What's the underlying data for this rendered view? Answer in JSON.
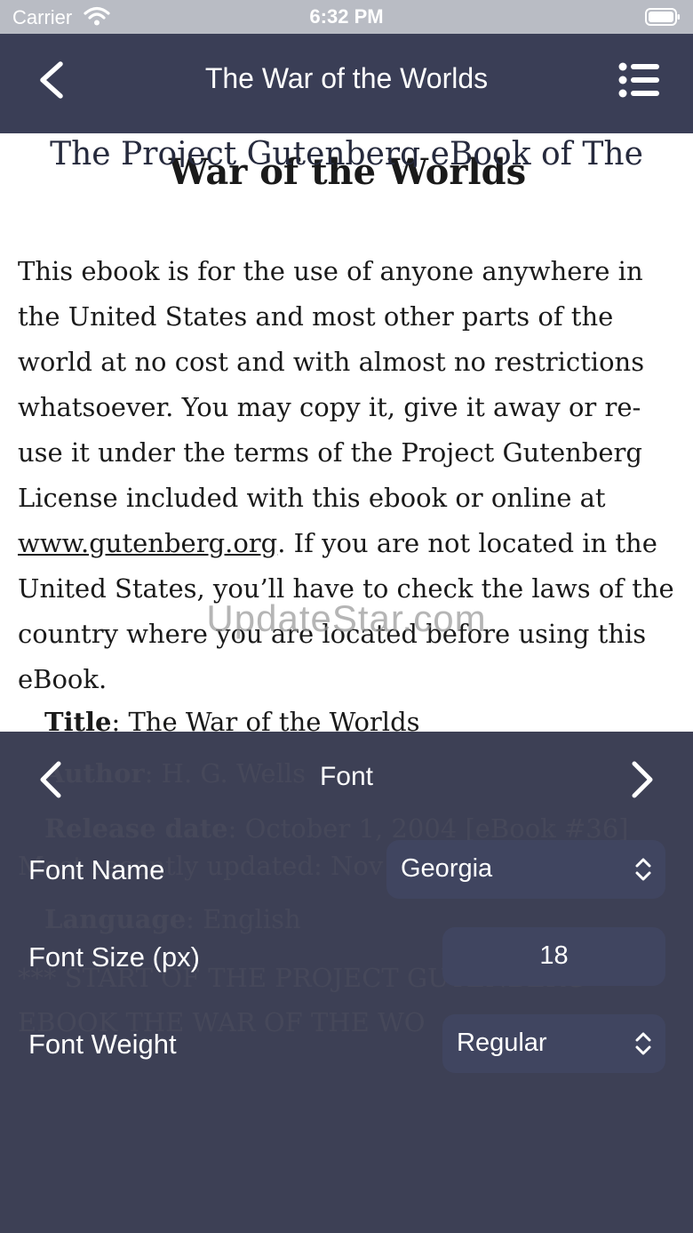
{
  "status_bar": {
    "carrier": "Carrier",
    "time": "6:32 PM"
  },
  "nav": {
    "title": "The War of the Worlds",
    "ghost_heading": "The Project Gutenberg eBook of The"
  },
  "book": {
    "heading": "War of the Worlds",
    "para_before_link": "This ebook is for the use of anyone anywhere in the United States and most other parts of the world at no cost and with almost no restrictions whatsoever. You may copy it, give it away or re-use it under the terms of the Project Gutenberg License included with this ebook or online at ",
    "link": "www.gutenberg.org",
    "para_after_link": ". If you are not located in the United States, you’ll have to check the laws of the country where you are located before using this eBook.",
    "title_label": "Title",
    "title_value": ": The War of the Worlds",
    "author_label": "Author",
    "author_value": ": H. G. Wells",
    "release_label": "Release date",
    "release_value": ": October 1, 2004 [eBook #36]",
    "updated_line": "Most recently updated: Nov",
    "language_label": "Language",
    "language_value": ": English",
    "start_line1": "*** START OF THE PROJECT GUTENBERG",
    "start_line2": "EBOOK THE WAR OF THE WO"
  },
  "watermark": "UpdateStar.com",
  "font_panel": {
    "title": "Font",
    "font_name_label": "Font Name",
    "font_name_value": "Georgia",
    "font_size_label": "Font Size (px)",
    "font_size_value": "18",
    "font_weight_label": "Font Weight",
    "font_weight_value": "Regular"
  },
  "icons": {
    "wifi": "wifi-icon",
    "battery": "battery-icon",
    "back": "chevron-left-icon",
    "menu": "list-icon",
    "prev": "chevron-left-icon",
    "next": "chevron-right-icon",
    "select": "chevron-up-down-icon"
  }
}
